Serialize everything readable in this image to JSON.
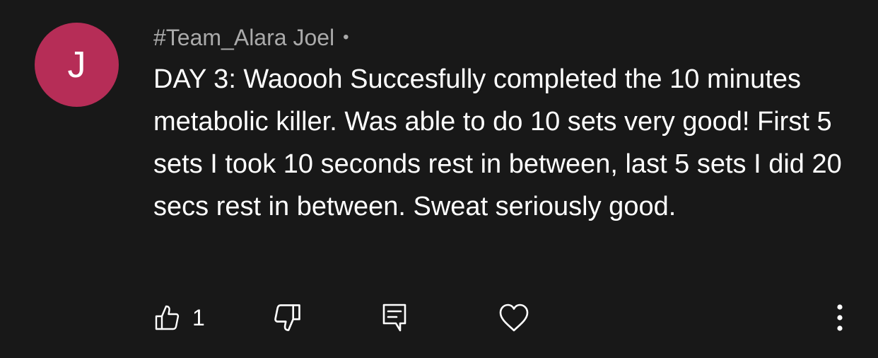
{
  "avatar": {
    "initial": "J",
    "color": "#b62d57"
  },
  "comment": {
    "author": "#Team_Alara Joel",
    "separator": "•",
    "text": "DAY 3: Waoooh Succesfully completed the 10 minutes metabolic killer. Was able to do 10 sets very good! First 5 sets I took 10 seconds rest in between, last 5 sets I did 20 secs rest in between. Sweat seriously good."
  },
  "actions": {
    "like_icon": "thumbs-up-icon",
    "like_count": "1",
    "dislike_icon": "thumbs-down-icon",
    "reply_icon": "reply-comment-icon",
    "heart_icon": "heart-icon",
    "more_icon": "more-vertical-icon"
  },
  "colors": {
    "background": "#181818",
    "text": "#ffffff",
    "secondary_text": "#aaaaaa"
  }
}
